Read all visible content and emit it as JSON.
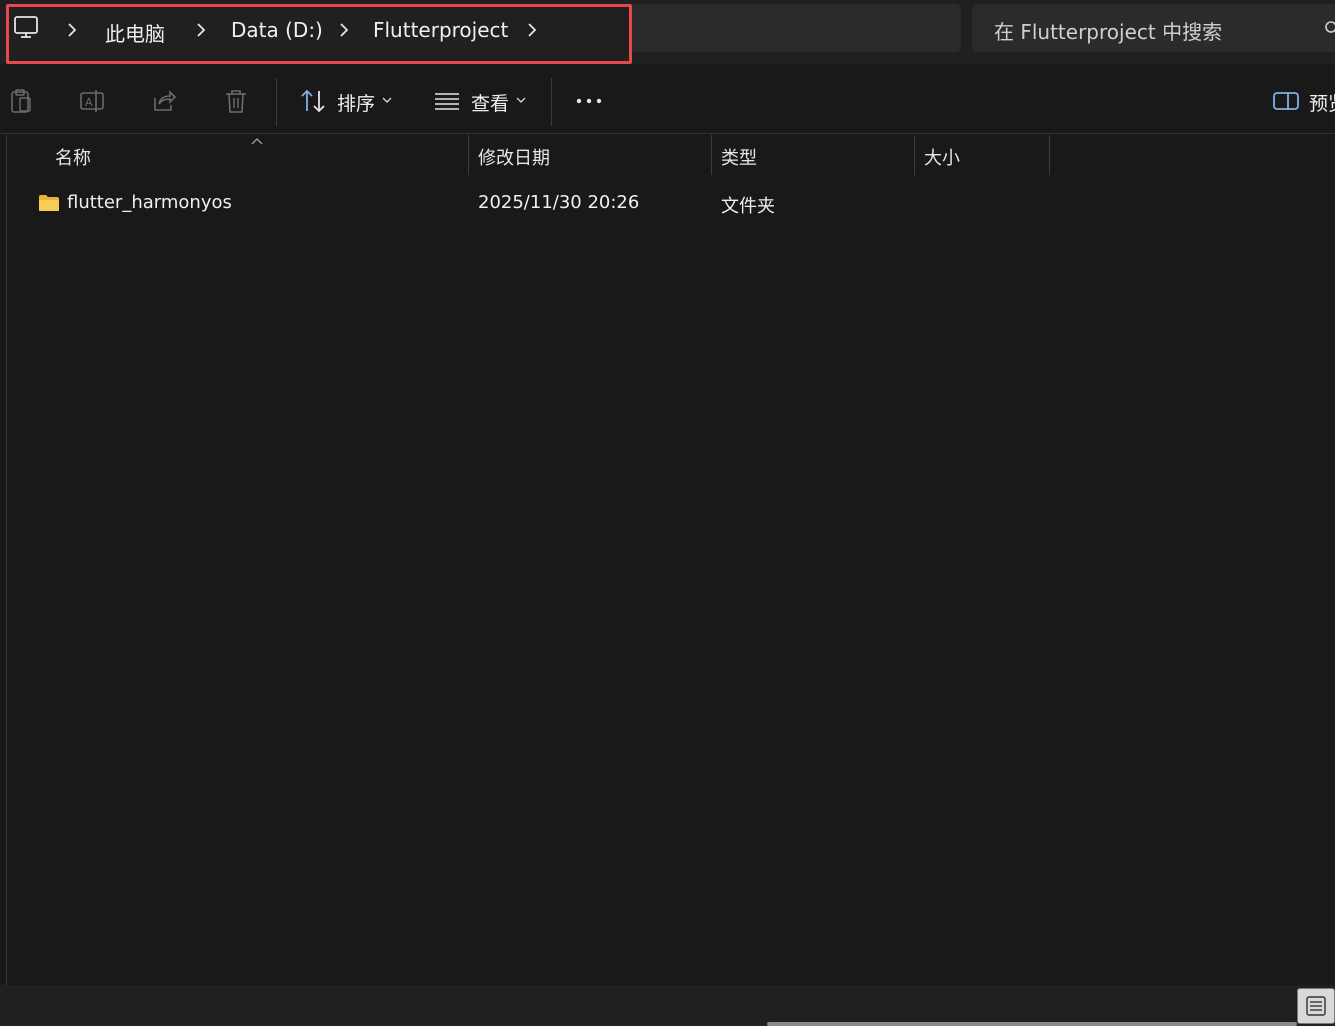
{
  "address_bar": {
    "root_icon": "computer-icon",
    "crumbs": [
      "此电脑",
      "Data (D:)",
      "Flutterproject"
    ],
    "highlight_color": "#e5484d"
  },
  "search": {
    "placeholder": "在 Flutterproject 中搜索",
    "icon": "search-icon"
  },
  "toolbar": {
    "icons": [
      "paste-icon",
      "rename-icon",
      "share-icon",
      "delete-icon"
    ],
    "sort_label": "排序",
    "view_label": "查看",
    "more_icon": "more-icon",
    "preview_label": "预览"
  },
  "columns": {
    "name": "名称",
    "modified": "修改日期",
    "type": "类型",
    "size": "大小"
  },
  "files": [
    {
      "name": "flutter_harmonyos",
      "modified": "2025/11/30 20:26",
      "type": "文件夹",
      "size": "",
      "icon": "folder-icon"
    }
  ],
  "statusbar": {
    "view_icon": "list-view-icon"
  }
}
